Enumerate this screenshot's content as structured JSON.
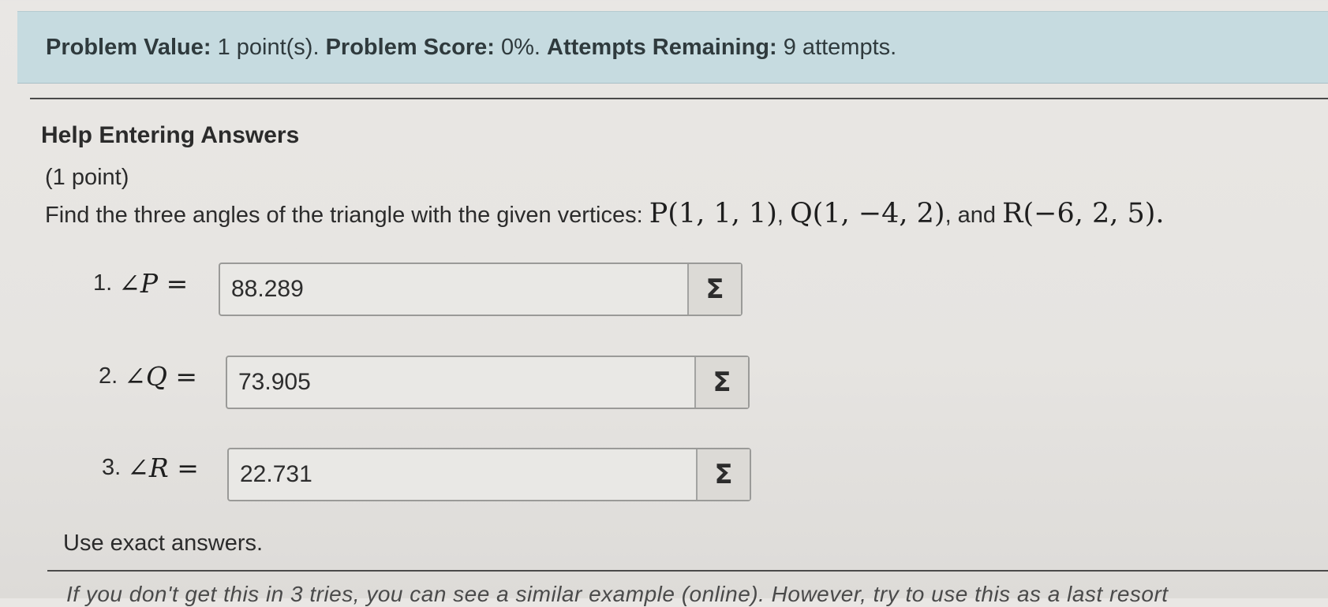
{
  "status": {
    "problem_value_label": "Problem Value:",
    "problem_value": "1 point(s).",
    "problem_score_label": "Problem Score:",
    "problem_score": "0%.",
    "attempts_label": "Attempts Remaining:",
    "attempts": "9 attempts."
  },
  "help_heading": "Help Entering Answers",
  "points": "(1 point)",
  "problem": {
    "text": "Find the three angles of the triangle with the given vertices:",
    "p": "P(1, 1, 1)",
    "q": "Q(1, −4, 2)",
    "and": "and",
    "r": "R(−6, 2, 5)."
  },
  "answers": [
    {
      "number": "1.",
      "angle": "∠",
      "vertex": "P",
      "equals": "=",
      "value": "88.289"
    },
    {
      "number": "2.",
      "angle": "∠",
      "vertex": "Q",
      "equals": "=",
      "value": "73.905"
    },
    {
      "number": "3.",
      "angle": "∠",
      "vertex": "R",
      "equals": "=",
      "value": "22.731"
    }
  ],
  "sigma_label": "Σ",
  "footer_note": "Use exact answers.",
  "cutoff_text": "If you don't get this in 3 tries, you can see a similar example (online). However, try to use this as a last resort"
}
